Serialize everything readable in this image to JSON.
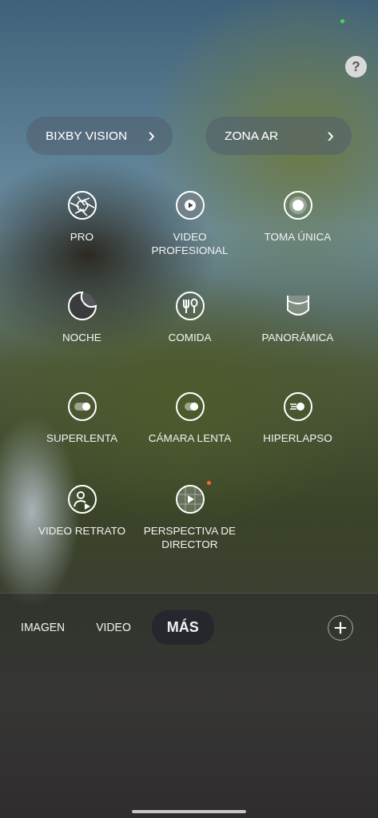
{
  "help": {
    "label": "?"
  },
  "quick_actions": [
    {
      "label": "BIXBY VISION",
      "chevron": "›"
    },
    {
      "label": "ZONA AR",
      "chevron": "›"
    }
  ],
  "modes": [
    {
      "label": "PRO",
      "new_badge": false
    },
    {
      "label": "VIDEO PROFESIONAL",
      "new_badge": false
    },
    {
      "label": "TOMA ÚNICA",
      "new_badge": false
    },
    {
      "label": "NOCHE",
      "new_badge": false
    },
    {
      "label": "COMIDA",
      "new_badge": false
    },
    {
      "label": "PANORÁMICA",
      "new_badge": false
    },
    {
      "label": "SUPERLENTA",
      "new_badge": false
    },
    {
      "label": "CÁMARA LENTA",
      "new_badge": false
    },
    {
      "label": "HIPERLAPSO",
      "new_badge": false
    },
    {
      "label": "VIDEO RETRATO",
      "new_badge": false
    },
    {
      "label": "PERSPECTIVA DE DIRECTOR",
      "new_badge": true
    }
  ],
  "tabs": [
    {
      "label": "IMAGEN",
      "selected": false
    },
    {
      "label": "VIDEO",
      "selected": false
    },
    {
      "label": "MÁS",
      "selected": true
    }
  ]
}
